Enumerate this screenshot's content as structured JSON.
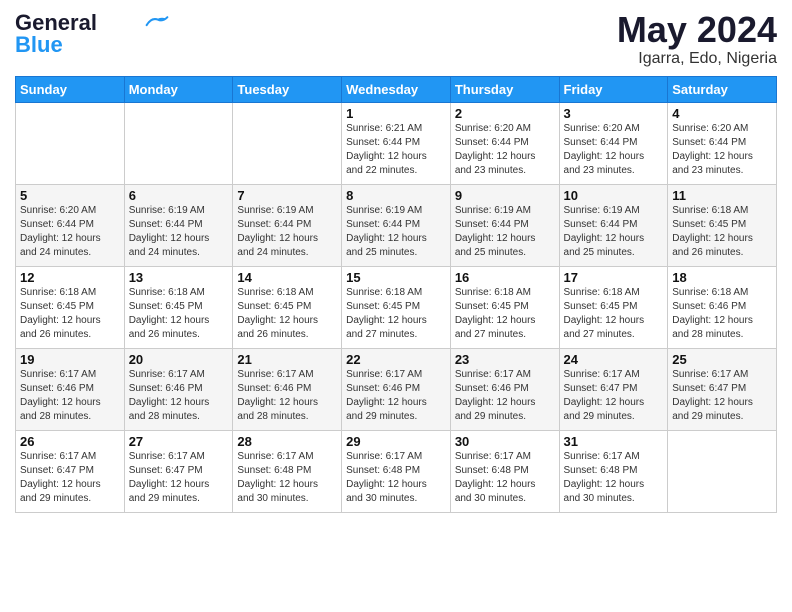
{
  "logo": {
    "line1": "General",
    "line2": "Blue"
  },
  "title": {
    "month_year": "May 2024",
    "location": "Igarra, Edo, Nigeria"
  },
  "days_of_week": [
    "Sunday",
    "Monday",
    "Tuesday",
    "Wednesday",
    "Thursday",
    "Friday",
    "Saturday"
  ],
  "weeks": [
    [
      {
        "day": "",
        "info": ""
      },
      {
        "day": "",
        "info": ""
      },
      {
        "day": "",
        "info": ""
      },
      {
        "day": "1",
        "info": "Sunrise: 6:21 AM\nSunset: 6:44 PM\nDaylight: 12 hours\nand 22 minutes."
      },
      {
        "day": "2",
        "info": "Sunrise: 6:20 AM\nSunset: 6:44 PM\nDaylight: 12 hours\nand 23 minutes."
      },
      {
        "day": "3",
        "info": "Sunrise: 6:20 AM\nSunset: 6:44 PM\nDaylight: 12 hours\nand 23 minutes."
      },
      {
        "day": "4",
        "info": "Sunrise: 6:20 AM\nSunset: 6:44 PM\nDaylight: 12 hours\nand 23 minutes."
      }
    ],
    [
      {
        "day": "5",
        "info": "Sunrise: 6:20 AM\nSunset: 6:44 PM\nDaylight: 12 hours\nand 24 minutes."
      },
      {
        "day": "6",
        "info": "Sunrise: 6:19 AM\nSunset: 6:44 PM\nDaylight: 12 hours\nand 24 minutes."
      },
      {
        "day": "7",
        "info": "Sunrise: 6:19 AM\nSunset: 6:44 PM\nDaylight: 12 hours\nand 24 minutes."
      },
      {
        "day": "8",
        "info": "Sunrise: 6:19 AM\nSunset: 6:44 PM\nDaylight: 12 hours\nand 25 minutes."
      },
      {
        "day": "9",
        "info": "Sunrise: 6:19 AM\nSunset: 6:44 PM\nDaylight: 12 hours\nand 25 minutes."
      },
      {
        "day": "10",
        "info": "Sunrise: 6:19 AM\nSunset: 6:44 PM\nDaylight: 12 hours\nand 25 minutes."
      },
      {
        "day": "11",
        "info": "Sunrise: 6:18 AM\nSunset: 6:45 PM\nDaylight: 12 hours\nand 26 minutes."
      }
    ],
    [
      {
        "day": "12",
        "info": "Sunrise: 6:18 AM\nSunset: 6:45 PM\nDaylight: 12 hours\nand 26 minutes."
      },
      {
        "day": "13",
        "info": "Sunrise: 6:18 AM\nSunset: 6:45 PM\nDaylight: 12 hours\nand 26 minutes."
      },
      {
        "day": "14",
        "info": "Sunrise: 6:18 AM\nSunset: 6:45 PM\nDaylight: 12 hours\nand 26 minutes."
      },
      {
        "day": "15",
        "info": "Sunrise: 6:18 AM\nSunset: 6:45 PM\nDaylight: 12 hours\nand 27 minutes."
      },
      {
        "day": "16",
        "info": "Sunrise: 6:18 AM\nSunset: 6:45 PM\nDaylight: 12 hours\nand 27 minutes."
      },
      {
        "day": "17",
        "info": "Sunrise: 6:18 AM\nSunset: 6:45 PM\nDaylight: 12 hours\nand 27 minutes."
      },
      {
        "day": "18",
        "info": "Sunrise: 6:18 AM\nSunset: 6:46 PM\nDaylight: 12 hours\nand 28 minutes."
      }
    ],
    [
      {
        "day": "19",
        "info": "Sunrise: 6:17 AM\nSunset: 6:46 PM\nDaylight: 12 hours\nand 28 minutes."
      },
      {
        "day": "20",
        "info": "Sunrise: 6:17 AM\nSunset: 6:46 PM\nDaylight: 12 hours\nand 28 minutes."
      },
      {
        "day": "21",
        "info": "Sunrise: 6:17 AM\nSunset: 6:46 PM\nDaylight: 12 hours\nand 28 minutes."
      },
      {
        "day": "22",
        "info": "Sunrise: 6:17 AM\nSunset: 6:46 PM\nDaylight: 12 hours\nand 29 minutes."
      },
      {
        "day": "23",
        "info": "Sunrise: 6:17 AM\nSunset: 6:46 PM\nDaylight: 12 hours\nand 29 minutes."
      },
      {
        "day": "24",
        "info": "Sunrise: 6:17 AM\nSunset: 6:47 PM\nDaylight: 12 hours\nand 29 minutes."
      },
      {
        "day": "25",
        "info": "Sunrise: 6:17 AM\nSunset: 6:47 PM\nDaylight: 12 hours\nand 29 minutes."
      }
    ],
    [
      {
        "day": "26",
        "info": "Sunrise: 6:17 AM\nSunset: 6:47 PM\nDaylight: 12 hours\nand 29 minutes."
      },
      {
        "day": "27",
        "info": "Sunrise: 6:17 AM\nSunset: 6:47 PM\nDaylight: 12 hours\nand 29 minutes."
      },
      {
        "day": "28",
        "info": "Sunrise: 6:17 AM\nSunset: 6:48 PM\nDaylight: 12 hours\nand 30 minutes."
      },
      {
        "day": "29",
        "info": "Sunrise: 6:17 AM\nSunset: 6:48 PM\nDaylight: 12 hours\nand 30 minutes."
      },
      {
        "day": "30",
        "info": "Sunrise: 6:17 AM\nSunset: 6:48 PM\nDaylight: 12 hours\nand 30 minutes."
      },
      {
        "day": "31",
        "info": "Sunrise: 6:17 AM\nSunset: 6:48 PM\nDaylight: 12 hours\nand 30 minutes."
      },
      {
        "day": "",
        "info": ""
      }
    ]
  ]
}
